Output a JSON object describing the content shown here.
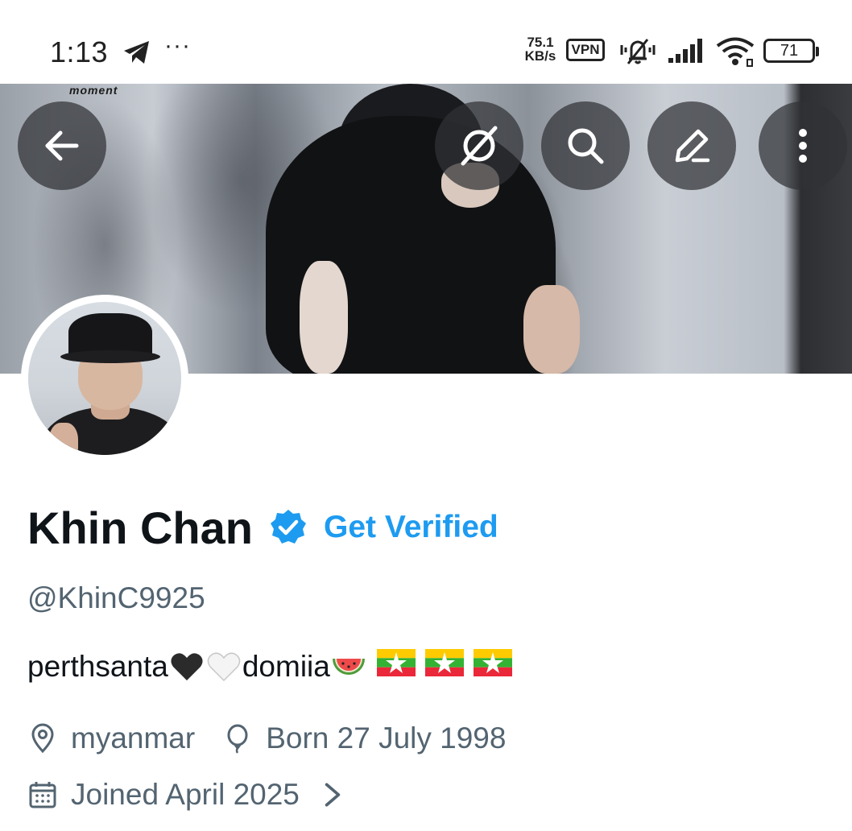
{
  "status_bar": {
    "time": "1:13",
    "more_indicator": "···",
    "net_speed_value": "75.1",
    "net_speed_unit": "KB/s",
    "vpn": "VPN",
    "battery": "71",
    "icons": [
      "telegram-icon",
      "mute-icon",
      "signal-icon",
      "wifi-icon",
      "battery-icon"
    ]
  },
  "banner": {
    "overlay_text": "moment"
  },
  "toolbar": {
    "buttons": [
      "back-icon",
      "grok-icon",
      "search-icon",
      "edit-icon",
      "more-icon"
    ]
  },
  "profile": {
    "display_name": "Khin Chan",
    "get_verified_label": "Get Verified",
    "handle": "@KhinC9925",
    "bio": {
      "part1": "perthsanta",
      "part2": " domiia"
    },
    "location": "myanmar",
    "birthday": "Born 27 July 1998",
    "joined": "Joined April 2025"
  },
  "colors": {
    "accent": "#1d9bf0",
    "text_primary": "#0f1419",
    "text_secondary": "#536471"
  }
}
